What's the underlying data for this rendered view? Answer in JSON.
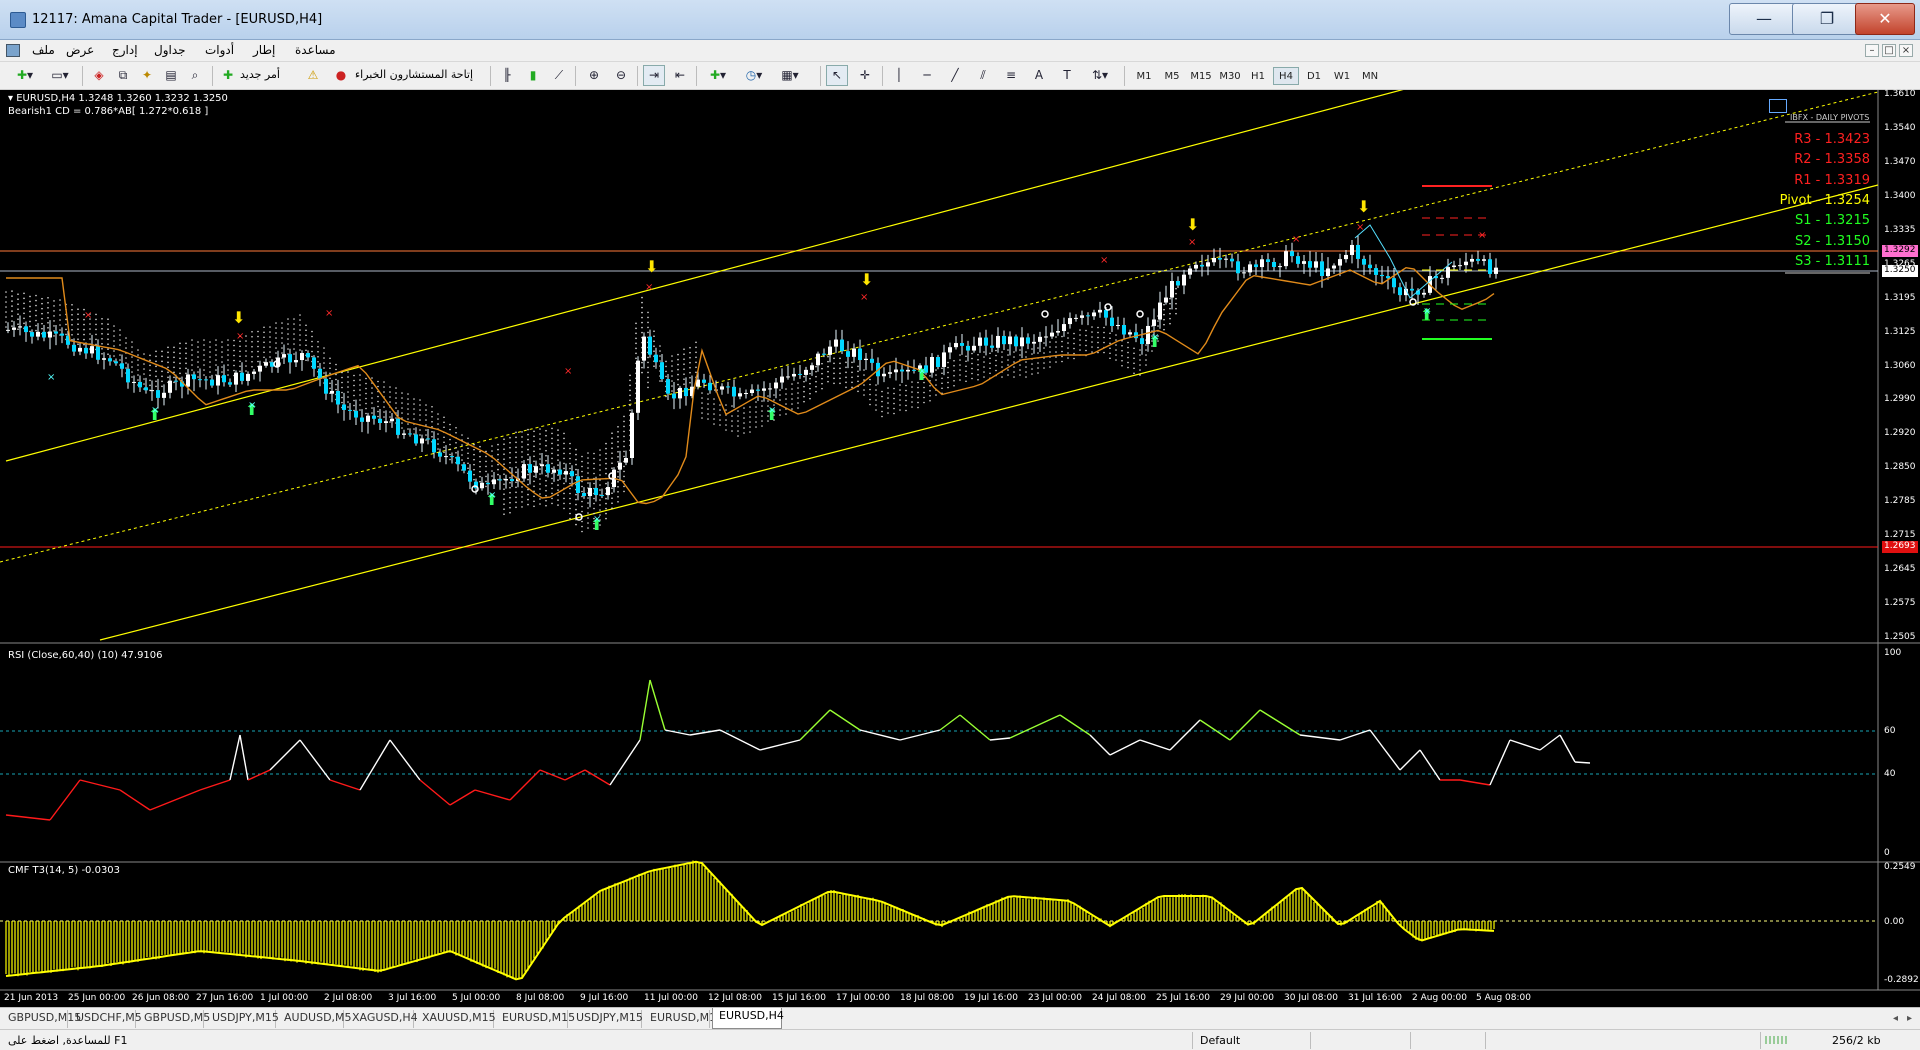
{
  "window": {
    "title": "12117: Amana Capital Trader - [EURUSD,H4]",
    "minimize_glyph": "—",
    "maximize_glyph": "❐",
    "close_glyph": "✕"
  },
  "menu": {
    "items": [
      "ملف",
      "عرض",
      "إدارج",
      "جداول",
      "أدوات",
      "إطار",
      "مساعدة"
    ]
  },
  "toolbar": {
    "expert_advisors_label": "إتاحة المستشارون الخبراء",
    "new_order_label": "أمر جديد",
    "timeframes": [
      "M1",
      "M5",
      "M15",
      "M30",
      "H1",
      "H4",
      "D1",
      "W1",
      "MN"
    ],
    "active_timeframe": "H4"
  },
  "chart": {
    "symbol_info": "EURUSD,H4  1.3248 1.3260 1.3232 1.3250",
    "pattern_info": "Bearish1 CD = 0.786*AB[ 1.272*0.618 ]",
    "price_axis": [
      "1.3610",
      "1.3540",
      "1.3470",
      "1.3400",
      "1.3335",
      "1.3265",
      "1.3195",
      "1.3125",
      "1.3060",
      "1.2990",
      "1.2920",
      "1.2850",
      "1.2785",
      "1.2715",
      "1.2645",
      "1.2575",
      "1.2505"
    ],
    "current_price_flag": "1.3250",
    "top_line_flag": "1.3292",
    "bottom_line_flag": "1.2693",
    "pivots_title": "IBFX - DAILY PIVOTS",
    "pivots": [
      {
        "label": "R3 - 1.3423",
        "color": "#ff2020"
      },
      {
        "label": "R2 - 1.3358",
        "color": "#ff2020"
      },
      {
        "label": "R1 - 1.3319",
        "color": "#ff2020"
      },
      {
        "label": "Pivot - 1.3254",
        "color": "#ffff00"
      },
      {
        "label": "S1 - 1.3215",
        "color": "#20ff20"
      },
      {
        "label": "S2 - 1.3150",
        "color": "#20ff20"
      },
      {
        "label": "S3 - 1.3111",
        "color": "#20ff20"
      }
    ],
    "rsi_label": "RSI (Close,60,40) (10) 47.9106",
    "rsi_axis": [
      "100",
      "60",
      "40",
      "0"
    ],
    "cmf_label": "CMF T3(14, 5) -0.0303",
    "cmf_axis": [
      "0.2549",
      "0.00",
      "-0.2892"
    ],
    "time_axis": [
      "21 Jun 2013",
      "25 Jun 00:00",
      "26 Jun 08:00",
      "27 Jun 16:00",
      "1 Jul 00:00",
      "2 Jul 08:00",
      "3 Jul 16:00",
      "5 Jul 00:00",
      "8 Jul 08:00",
      "9 Jul 16:00",
      "11 Jul 00:00",
      "12 Jul 08:00",
      "15 Jul 16:00",
      "17 Jul 00:00",
      "18 Jul 08:00",
      "19 Jul 16:00",
      "23 Jul 00:00",
      "24 Jul 08:00",
      "25 Jul 16:00",
      "29 Jul 00:00",
      "30 Jul 08:00",
      "31 Jul 16:00",
      "2 Aug 00:00",
      "5 Aug 08:00"
    ]
  },
  "tabs": {
    "items": [
      "GBPUSD,M15",
      "USDCHF,M5",
      "GBPUSD,M5",
      "USDJPY,M15",
      "AUDUSD,M5",
      "XAGUSD,H4",
      "XAUUSD,M15",
      "EURUSD,M15",
      "USDJPY,M15",
      "EURUSD,M1",
      "EURUSD,H4"
    ],
    "active": "EURUSD,H4"
  },
  "status": {
    "help": "للمساعدة, اضغط على F1",
    "profile": "Default",
    "traffic": "256/2 kb"
  }
}
